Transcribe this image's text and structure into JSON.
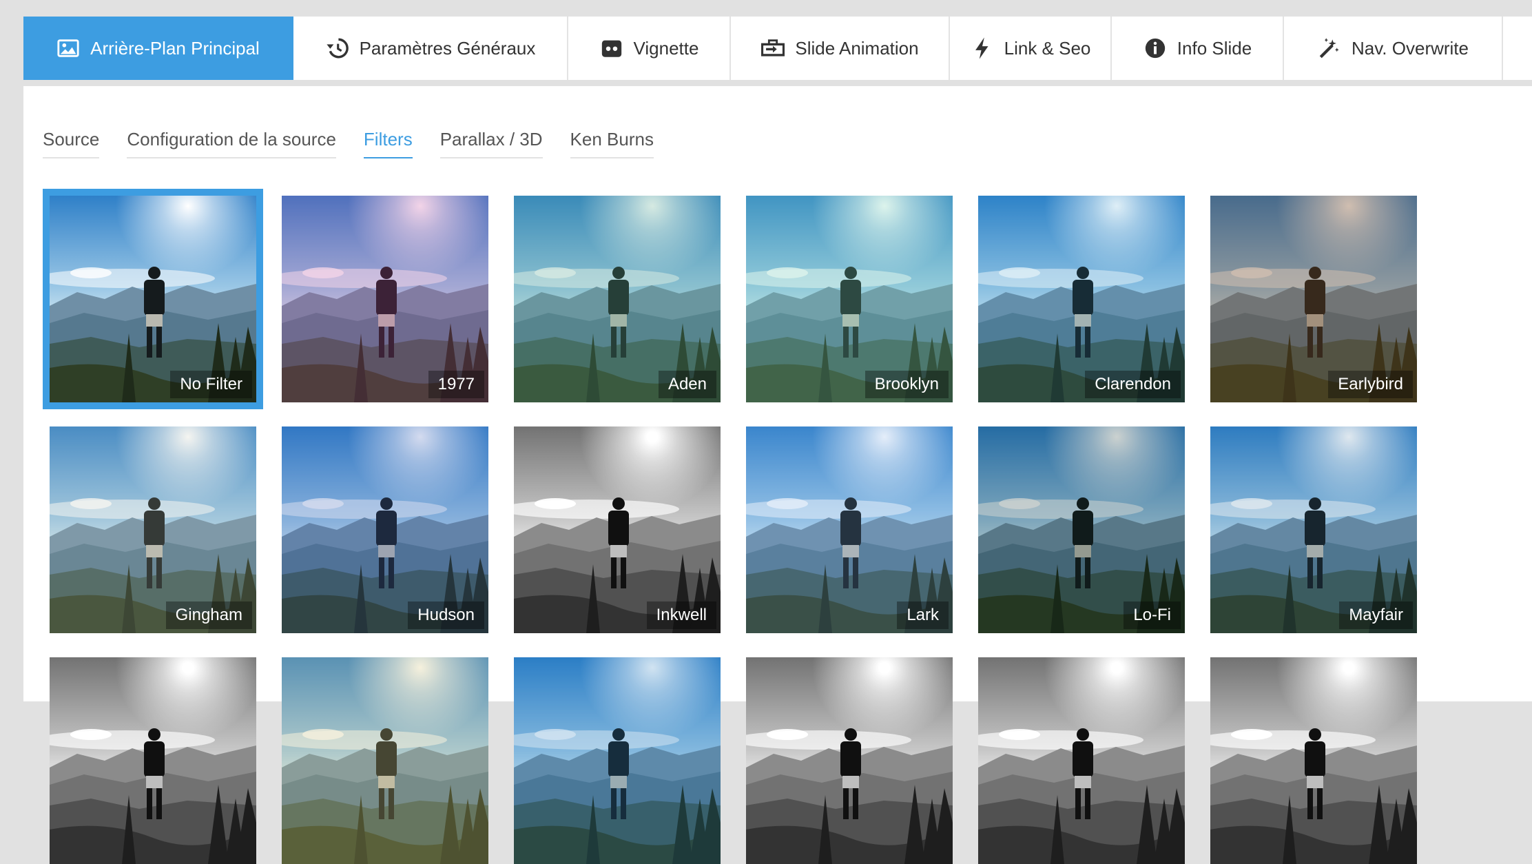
{
  "top_tabs": [
    {
      "label": "Arrière-Plan Principal",
      "icon": "image-icon",
      "active": true
    },
    {
      "label": "Paramètres Généraux",
      "icon": "history-icon",
      "active": false
    },
    {
      "label": "Vignette",
      "icon": "thumbnail-icon",
      "active": false
    },
    {
      "label": "Slide Animation",
      "icon": "slide-animation-icon",
      "active": false
    },
    {
      "label": "Link & Seo",
      "icon": "bolt-icon",
      "active": false
    },
    {
      "label": "Info Slide",
      "icon": "info-icon",
      "active": false
    },
    {
      "label": "Nav. Overwrite",
      "icon": "magic-wand-icon",
      "active": false
    }
  ],
  "sub_tabs": [
    {
      "label": "Source",
      "active": false
    },
    {
      "label": "Configuration de la source",
      "active": false
    },
    {
      "label": "Filters",
      "active": true
    },
    {
      "label": "Parallax / 3D",
      "active": false
    },
    {
      "label": "Ken Burns",
      "active": false
    }
  ],
  "filters": [
    {
      "label": "No Filter",
      "selected": true
    },
    {
      "label": "1977",
      "selected": false
    },
    {
      "label": "Aden",
      "selected": false
    },
    {
      "label": "Brooklyn",
      "selected": false
    },
    {
      "label": "Clarendon",
      "selected": false
    },
    {
      "label": "Earlybird",
      "selected": false
    },
    {
      "label": "Gingham",
      "selected": false
    },
    {
      "label": "Hudson",
      "selected": false
    },
    {
      "label": "Inkwell",
      "selected": false
    },
    {
      "label": "Lark",
      "selected": false
    },
    {
      "label": "Lo-Fi",
      "selected": false
    },
    {
      "label": "Mayfair",
      "selected": false
    },
    {
      "label": "",
      "selected": false
    },
    {
      "label": "",
      "selected": false
    },
    {
      "label": "",
      "selected": false
    },
    {
      "label": "",
      "selected": false
    },
    {
      "label": "",
      "selected": false
    },
    {
      "label": "",
      "selected": false
    }
  ],
  "colors": {
    "accent": "#3d9de1",
    "background": "#e1e1e1",
    "panel": "#ffffff"
  }
}
